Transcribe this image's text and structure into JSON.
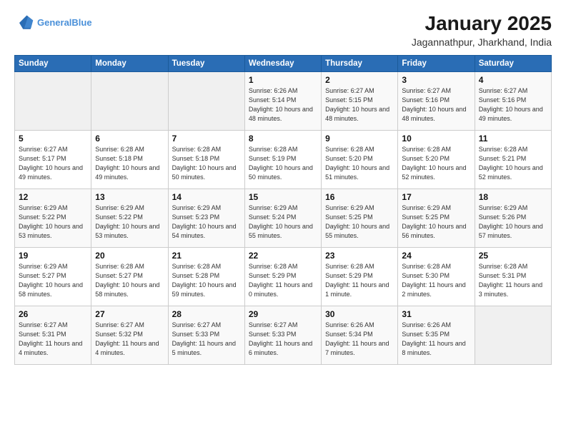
{
  "header": {
    "logo_line1": "General",
    "logo_line2": "Blue",
    "title": "January 2025",
    "subtitle": "Jagannathpur, Jharkhand, India"
  },
  "days_of_week": [
    "Sunday",
    "Monday",
    "Tuesday",
    "Wednesday",
    "Thursday",
    "Friday",
    "Saturday"
  ],
  "weeks": [
    [
      {
        "day": "",
        "sunrise": "",
        "sunset": "",
        "daylight": ""
      },
      {
        "day": "",
        "sunrise": "",
        "sunset": "",
        "daylight": ""
      },
      {
        "day": "",
        "sunrise": "",
        "sunset": "",
        "daylight": ""
      },
      {
        "day": "1",
        "sunrise": "6:26 AM",
        "sunset": "5:14 PM",
        "daylight": "10 hours and 48 minutes."
      },
      {
        "day": "2",
        "sunrise": "6:27 AM",
        "sunset": "5:15 PM",
        "daylight": "10 hours and 48 minutes."
      },
      {
        "day": "3",
        "sunrise": "6:27 AM",
        "sunset": "5:16 PM",
        "daylight": "10 hours and 48 minutes."
      },
      {
        "day": "4",
        "sunrise": "6:27 AM",
        "sunset": "5:16 PM",
        "daylight": "10 hours and 49 minutes."
      }
    ],
    [
      {
        "day": "5",
        "sunrise": "6:27 AM",
        "sunset": "5:17 PM",
        "daylight": "10 hours and 49 minutes."
      },
      {
        "day": "6",
        "sunrise": "6:28 AM",
        "sunset": "5:18 PM",
        "daylight": "10 hours and 49 minutes."
      },
      {
        "day": "7",
        "sunrise": "6:28 AM",
        "sunset": "5:18 PM",
        "daylight": "10 hours and 50 minutes."
      },
      {
        "day": "8",
        "sunrise": "6:28 AM",
        "sunset": "5:19 PM",
        "daylight": "10 hours and 50 minutes."
      },
      {
        "day": "9",
        "sunrise": "6:28 AM",
        "sunset": "5:20 PM",
        "daylight": "10 hours and 51 minutes."
      },
      {
        "day": "10",
        "sunrise": "6:28 AM",
        "sunset": "5:20 PM",
        "daylight": "10 hours and 52 minutes."
      },
      {
        "day": "11",
        "sunrise": "6:28 AM",
        "sunset": "5:21 PM",
        "daylight": "10 hours and 52 minutes."
      }
    ],
    [
      {
        "day": "12",
        "sunrise": "6:29 AM",
        "sunset": "5:22 PM",
        "daylight": "10 hours and 53 minutes."
      },
      {
        "day": "13",
        "sunrise": "6:29 AM",
        "sunset": "5:22 PM",
        "daylight": "10 hours and 53 minutes."
      },
      {
        "day": "14",
        "sunrise": "6:29 AM",
        "sunset": "5:23 PM",
        "daylight": "10 hours and 54 minutes."
      },
      {
        "day": "15",
        "sunrise": "6:29 AM",
        "sunset": "5:24 PM",
        "daylight": "10 hours and 55 minutes."
      },
      {
        "day": "16",
        "sunrise": "6:29 AM",
        "sunset": "5:25 PM",
        "daylight": "10 hours and 55 minutes."
      },
      {
        "day": "17",
        "sunrise": "6:29 AM",
        "sunset": "5:25 PM",
        "daylight": "10 hours and 56 minutes."
      },
      {
        "day": "18",
        "sunrise": "6:29 AM",
        "sunset": "5:26 PM",
        "daylight": "10 hours and 57 minutes."
      }
    ],
    [
      {
        "day": "19",
        "sunrise": "6:29 AM",
        "sunset": "5:27 PM",
        "daylight": "10 hours and 58 minutes."
      },
      {
        "day": "20",
        "sunrise": "6:28 AM",
        "sunset": "5:27 PM",
        "daylight": "10 hours and 58 minutes."
      },
      {
        "day": "21",
        "sunrise": "6:28 AM",
        "sunset": "5:28 PM",
        "daylight": "10 hours and 59 minutes."
      },
      {
        "day": "22",
        "sunrise": "6:28 AM",
        "sunset": "5:29 PM",
        "daylight": "11 hours and 0 minutes."
      },
      {
        "day": "23",
        "sunrise": "6:28 AM",
        "sunset": "5:29 PM",
        "daylight": "11 hours and 1 minute."
      },
      {
        "day": "24",
        "sunrise": "6:28 AM",
        "sunset": "5:30 PM",
        "daylight": "11 hours and 2 minutes."
      },
      {
        "day": "25",
        "sunrise": "6:28 AM",
        "sunset": "5:31 PM",
        "daylight": "11 hours and 3 minutes."
      }
    ],
    [
      {
        "day": "26",
        "sunrise": "6:27 AM",
        "sunset": "5:31 PM",
        "daylight": "11 hours and 4 minutes."
      },
      {
        "day": "27",
        "sunrise": "6:27 AM",
        "sunset": "5:32 PM",
        "daylight": "11 hours and 4 minutes."
      },
      {
        "day": "28",
        "sunrise": "6:27 AM",
        "sunset": "5:33 PM",
        "daylight": "11 hours and 5 minutes."
      },
      {
        "day": "29",
        "sunrise": "6:27 AM",
        "sunset": "5:33 PM",
        "daylight": "11 hours and 6 minutes."
      },
      {
        "day": "30",
        "sunrise": "6:26 AM",
        "sunset": "5:34 PM",
        "daylight": "11 hours and 7 minutes."
      },
      {
        "day": "31",
        "sunrise": "6:26 AM",
        "sunset": "5:35 PM",
        "daylight": "11 hours and 8 minutes."
      },
      {
        "day": "",
        "sunrise": "",
        "sunset": "",
        "daylight": ""
      }
    ]
  ]
}
